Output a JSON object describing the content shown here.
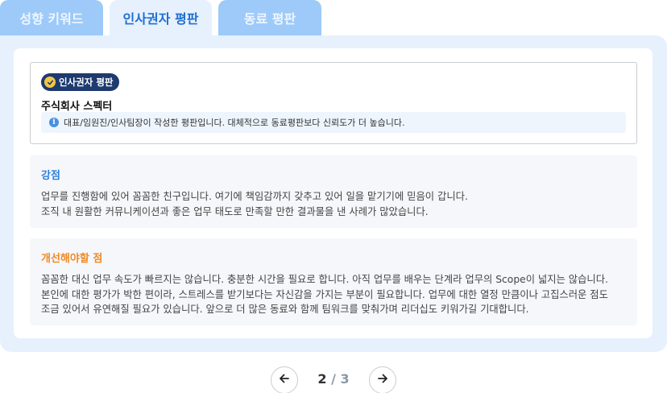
{
  "tabs": [
    {
      "label": "성향 키워드",
      "active": false
    },
    {
      "label": "인사권자 평판",
      "active": true
    },
    {
      "label": "동료 평판",
      "active": false
    }
  ],
  "reviewer": {
    "badge_label": "인사권자 평판",
    "badge_icon": "check-badge-icon",
    "company": "주식회사 스펙터",
    "note_icon": "info-icon",
    "note": "대표/임원진/인사팀장이 작성한 평판입니다. 대체적으로 동료평판보다 신뢰도가 더 높습니다."
  },
  "strengths": {
    "title": "강점",
    "lines": [
      "업무를 진행함에 있어 꼼꼼한 친구입니다. 여기에 책임감까지 갖추고 있어 일을 맡기기에 믿음이 갑니다.",
      "조직 내 원활한 커뮤니케이션과 좋은 업무 태도로 만족할 만한 결과물을 낸 사례가 많았습니다."
    ]
  },
  "improvements": {
    "title": "개선해야할 점",
    "lines": [
      "꼼꼼한 대신 업무 속도가 빠르지는 않습니다. 충분한 시간을 필요로 합니다. 아직 업무를 배우는 단계라 업무의 Scope이 넓지는 않습니다.",
      "본인에 대한 평가가 박한 편이라, 스트레스를 받기보다는 자신감을 가지는 부분이 필요합니다. 업무에 대한 열정 만큼이나 고집스러운 점도",
      "조금 있어서 유연해질 필요가 있습니다. 앞으로 더 많은 동료와 함께 팀워크를 맞춰가며 리더십도 키워가길 기대합니다."
    ]
  },
  "pagination": {
    "current": "2",
    "separator": "/",
    "total": "3",
    "prev_icon": "arrow-left-icon",
    "next_icon": "arrow-right-icon"
  },
  "colors": {
    "accent": "#1f6fd0",
    "tab_inactive": "#9dcaf8",
    "panel_bg": "#e6f1fd",
    "badge_bg": "#1e3a6e",
    "strength_title": "#2f7fd8",
    "improve_title": "#f08a24"
  }
}
